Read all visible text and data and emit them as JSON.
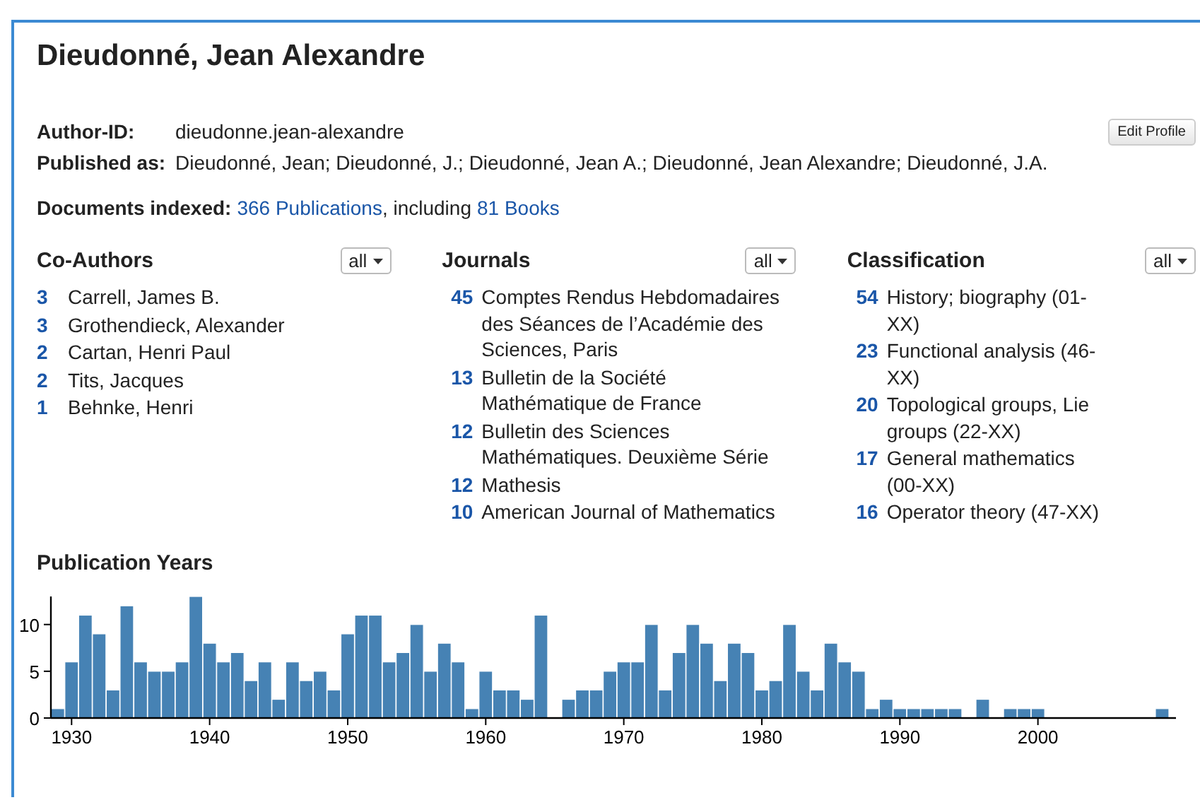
{
  "title": "Dieudonné, Jean Alexandre",
  "author_id": {
    "label": "Author-ID:",
    "value": "dieudonne.jean-alexandre"
  },
  "published_as": {
    "label": "Published as:",
    "value": "Dieudonné, Jean; Dieudonné, J.; Dieudonné, Jean A.; Dieudonné, Jean Alexandre; Dieudonné, J.A."
  },
  "edit_button": "Edit Profile",
  "documents": {
    "label": "Documents indexed:",
    "publications": "366 Publications",
    "middle": ", including",
    "books": "81 Books"
  },
  "columns": [
    {
      "title": "Co-Authors",
      "filter": "all",
      "items": [
        {
          "count": "3",
          "name": "Carrell, James B."
        },
        {
          "count": "3",
          "name": "Grothendieck, Alexander"
        },
        {
          "count": "2",
          "name": "Cartan, Henri Paul"
        },
        {
          "count": "2",
          "name": "Tits, Jacques"
        },
        {
          "count": "1",
          "name": "Behnke, Henri"
        }
      ]
    },
    {
      "title": "Journals",
      "filter": "all",
      "items": [
        {
          "count": "45",
          "name": "Comptes Rendus Hebdomadaires des Séances de l’Académie des Sciences, Paris"
        },
        {
          "count": "13",
          "name": "Bulletin de la Société Mathématique de France"
        },
        {
          "count": "12",
          "name": "Bulletin des Sciences Mathématiques. Deuxième Série"
        },
        {
          "count": "12",
          "name": "Mathesis"
        },
        {
          "count": "10",
          "name": "American Journal of Mathematics"
        }
      ]
    },
    {
      "title": "Classification",
      "filter": "all",
      "items": [
        {
          "count": "54",
          "name": "History; biography (01-XX)"
        },
        {
          "count": "23",
          "name": "Functional analysis (46-XX)"
        },
        {
          "count": "20",
          "name": "Topological groups, Lie groups (22-XX)"
        },
        {
          "count": "17",
          "name": "General mathematics (00-XX)"
        },
        {
          "count": "16",
          "name": "Operator theory (47-XX)"
        }
      ]
    }
  ],
  "publication_years": {
    "title": "Publication Years",
    "chart_data": {
      "type": "bar",
      "x": [
        1929,
        1930,
        1931,
        1932,
        1933,
        1934,
        1935,
        1936,
        1937,
        1938,
        1939,
        1940,
        1941,
        1942,
        1943,
        1944,
        1945,
        1946,
        1947,
        1948,
        1949,
        1950,
        1951,
        1952,
        1953,
        1954,
        1955,
        1956,
        1957,
        1958,
        1959,
        1960,
        1961,
        1962,
        1963,
        1964,
        1965,
        1966,
        1967,
        1968,
        1969,
        1970,
        1971,
        1972,
        1973,
        1974,
        1975,
        1976,
        1977,
        1978,
        1979,
        1980,
        1981,
        1982,
        1983,
        1984,
        1985,
        1986,
        1987,
        1988,
        1989,
        1990,
        1991,
        1992,
        1993,
        1994,
        1995,
        1996,
        1997,
        1998,
        1999,
        2000,
        2001,
        2002,
        2003,
        2004,
        2005,
        2006,
        2007,
        2008,
        2009
      ],
      "values": [
        1,
        6,
        11,
        9,
        3,
        12,
        6,
        5,
        5,
        6,
        13,
        8,
        6,
        7,
        4,
        6,
        2,
        6,
        4,
        5,
        3,
        9,
        11,
        11,
        6,
        7,
        10,
        5,
        8,
        6,
        1,
        5,
        3,
        3,
        2,
        11,
        0,
        2,
        3,
        3,
        5,
        6,
        6,
        10,
        3,
        7,
        10,
        8,
        4,
        8,
        7,
        3,
        4,
        10,
        5,
        3,
        8,
        6,
        5,
        1,
        2,
        1,
        1,
        1,
        1,
        1,
        0,
        2,
        0,
        1,
        1,
        1,
        0,
        0,
        0,
        0,
        0,
        0,
        0,
        0,
        1
      ],
      "xticks": [
        1930,
        1940,
        1950,
        1960,
        1970,
        1980,
        1990,
        2000
      ],
      "xlim": [
        1928.5,
        2010
      ],
      "yticks": [
        0,
        5,
        10
      ],
      "ylim": [
        0,
        13
      ]
    }
  }
}
